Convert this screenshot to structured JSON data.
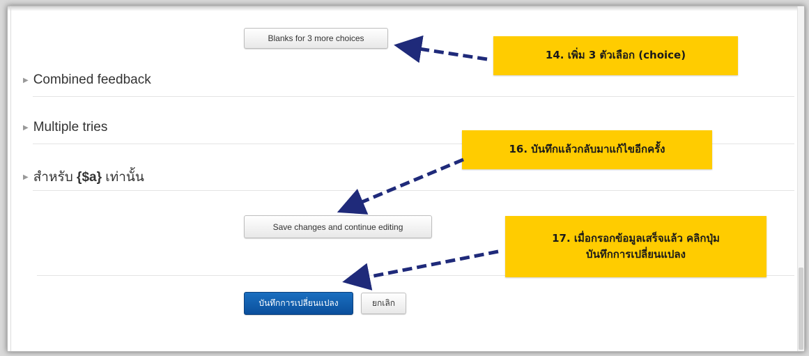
{
  "buttons": {
    "blanks_more": "Blanks for 3 more choices",
    "save_continue": "Save changes and continue editing",
    "save_changes": "บันทึกการเปลี่ยนแปลง",
    "cancel": "ยกเลิก"
  },
  "sections": [
    {
      "label": "Combined feedback"
    },
    {
      "label": "Multiple tries"
    },
    {
      "label_prefix": "สำหรับ ",
      "label_bold": "{$a}",
      "label_suffix": " เท่านั้น"
    }
  ],
  "callouts": {
    "step14": "14. เพิ่ม 3 ตัวเลือก (choice)",
    "step16": "16. บันทึกแล้วกลับมาแก้ไขอีกครั้ง",
    "step17_line1": "17. เมื่อกรอกข้อมูลเสร็จแล้ว คลิกปุ่ม",
    "step17_line2": "บันทึกการเปลี่ยนแปลง"
  },
  "colors": {
    "callout_bg": "#ffcc00",
    "arrow": "#1f2a7a",
    "primary_button": "#0b4f9c"
  }
}
